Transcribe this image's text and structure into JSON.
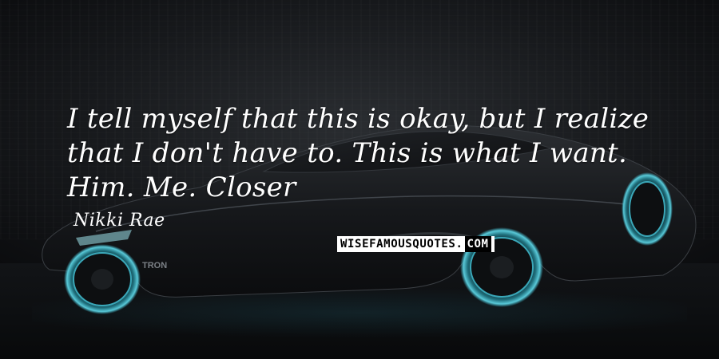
{
  "quote": {
    "text": "I tell myself that this is okay, but I realize that I don't have to. This is what I want. Him. Me. Closer",
    "author": "Nikki Rae"
  },
  "watermark": {
    "main": "WISEFAMOUSQUOTES",
    "dot": ".",
    "suffix": "COM"
  },
  "car_badge": "TRON",
  "colors": {
    "text": "#ffffff",
    "background": "#17191c",
    "wheel_glow": "#3fb6c8",
    "watermark_bg": "#ffffff"
  }
}
